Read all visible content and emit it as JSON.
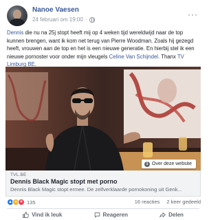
{
  "post": {
    "author": "Nanoe Vaesen",
    "timestamp": "24 februari om 19:00",
    "separator": "·",
    "menu_icon": "more-dots-icon",
    "text": {
      "mention_1": "Dennis",
      "part_1": " die nu na 25j stopt heeft mij op 4 weken tijd wereldwijd naar de top kunnen brengen, want ik kom net terug van Pierre Woodman. Zoals hij gezegd heeft, vrouwen aan de top en het is een nieuwe generatie. En hierbij stel ik een nieuwe pornoster voor onder mijn vleugels ",
      "mention_2": "Celine Van Schijndel",
      "part_2": ". Thanx ",
      "mention_3": "TV Limburg BE",
      "part_3": "."
    }
  },
  "link_preview": {
    "about_button": "Over deze website",
    "domain": "TVL.BE",
    "headline": "Dennis Black Magic stopt met porno",
    "description": "Dennis Black Magic stopt ermee. De zelfverklaarde pornokoning uit Genk..."
  },
  "stats": {
    "reaction_count": "135",
    "comments": "16 reacties",
    "shares": "2 keer gedeeld"
  },
  "actions": {
    "like": "Vind ik leuk",
    "comment": "Reageren",
    "share": "Delen"
  },
  "colors": {
    "link_blue": "#385898",
    "like_blue": "#2078f4",
    "wow_yellow": "#f7b125",
    "love_red": "#f33e58"
  }
}
